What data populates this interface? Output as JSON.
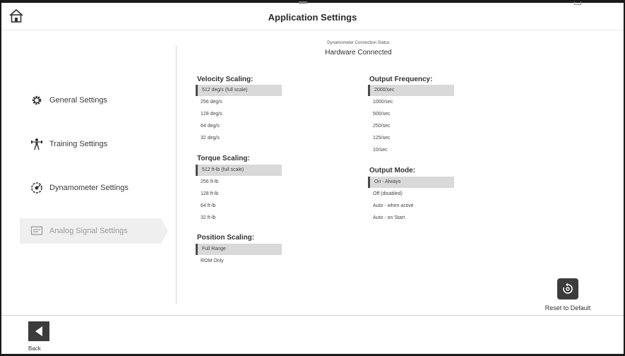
{
  "header": {
    "title": "Application Settings"
  },
  "sidebar": {
    "items": [
      {
        "label": "General Settings",
        "icon": "gear-icon"
      },
      {
        "label": "Training Settings",
        "icon": "person-icon"
      },
      {
        "label": "Dynamometer Settings",
        "icon": "dynamometer-icon"
      },
      {
        "label": "Analog Signal Settings",
        "icon": "signal-icon"
      }
    ]
  },
  "status": {
    "label": "Dynamometer Connection Status",
    "value": "Hardware Connected"
  },
  "velocity": {
    "title": "Velocity Scaling:",
    "options": [
      "512 deg/s (full scale)",
      "256 deg/s",
      "128 deg/s",
      "64 deg/s",
      "32 deg/s"
    ]
  },
  "torque": {
    "title": "Torque Scaling:",
    "options": [
      "512 ft-lb (full scale)",
      "256 ft-lb",
      "128 ft-lb",
      "64 ft-lb",
      "32 ft-lb"
    ]
  },
  "position": {
    "title": "Position Scaling:",
    "options": [
      "Full Range",
      "ROM Only"
    ]
  },
  "frequency": {
    "title": "Output Frequency:",
    "options": [
      "2000/sec",
      "1000/sec",
      "500/sec",
      "250/sec",
      "125/sec",
      "10/sec"
    ]
  },
  "mode": {
    "title": "Output Mode:",
    "options": [
      "On - Always",
      "Off (disabled)",
      "Auto - when active",
      "Auto - on Start"
    ]
  },
  "reset": {
    "label": "Reset to Default"
  },
  "footer": {
    "back_label": "Back"
  }
}
